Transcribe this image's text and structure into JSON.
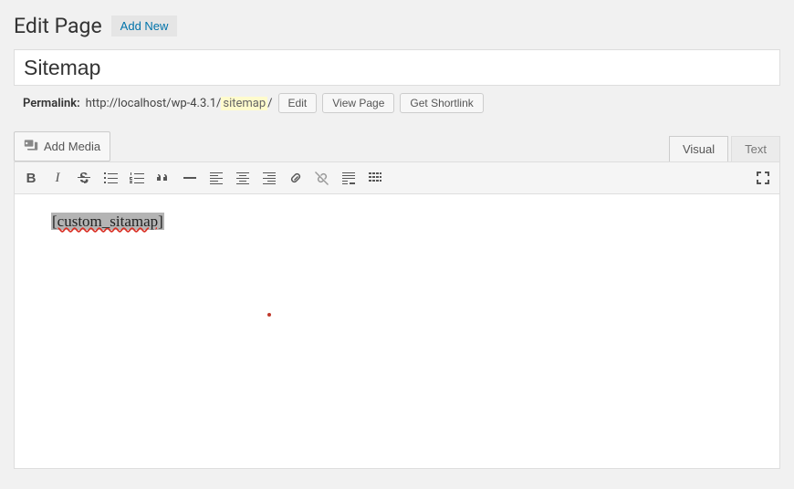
{
  "header": {
    "page_title": "Edit Page",
    "add_new_label": "Add New"
  },
  "title_input_value": "Sitemap",
  "permalink": {
    "label": "Permalink:",
    "base_url": "http://localhost/wp-4.3.1/",
    "slug": "sitemap",
    "trailing": "/",
    "edit_label": "Edit",
    "view_page_label": "View Page",
    "get_shortlink_label": "Get Shortlink"
  },
  "add_media_label": "Add Media",
  "tabs": {
    "visual": "Visual",
    "text": "Text"
  },
  "editor_content": "[custom_sitamap]",
  "toolbar_icons": [
    "bold-icon",
    "italic-icon",
    "strikethrough-icon",
    "bullet-list-icon",
    "numbered-list-icon",
    "blockquote-icon",
    "hr-icon",
    "align-left-icon",
    "align-center-icon",
    "align-right-icon",
    "link-icon",
    "unlink-icon",
    "more-icon",
    "toolbar-toggle-icon"
  ],
  "fullscreen_icon": "fullscreen-icon"
}
